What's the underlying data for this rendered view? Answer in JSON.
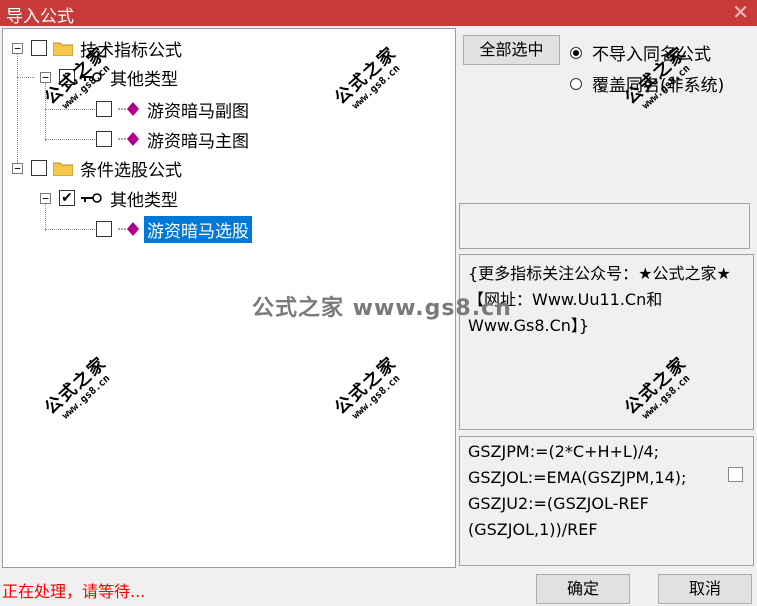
{
  "window": {
    "title": "导入公式",
    "close_glyph": "✕"
  },
  "tree": {
    "nodes": [
      {
        "label": "技术指标公式",
        "expander": "−",
        "checked": false,
        "icon": "folder-icon"
      },
      {
        "label": "其他类型",
        "expander": "−",
        "checked": false,
        "icon": "key-icon"
      },
      {
        "label": "游资暗马副图",
        "checked": false,
        "icon": "gem-icon"
      },
      {
        "label": "游资暗马主图",
        "checked": false,
        "icon": "gem-icon"
      },
      {
        "label": "条件选股公式",
        "expander": "−",
        "checked": false,
        "icon": "folder-icon"
      },
      {
        "label": "其他类型",
        "expander": "−",
        "checked": true,
        "icon": "key-icon"
      },
      {
        "label": "游资暗马选股",
        "checked": false,
        "icon": "gem-icon",
        "selected": true
      }
    ]
  },
  "right": {
    "select_all_label": "全部选中",
    "radio_no_import": "不导入同名公式",
    "radio_overwrite": "覆盖同名(非系统)",
    "desc_text": "{更多指标关注公众号：★公式之家★ 【网址：Www.Uu11.Cn和Www.Gs8.Cn】}",
    "code_lines": [
      "GSZJPM:=(2*C+H+L)/4;",
      "GSZJOL:=EMA(GSZJPM,14);",
      "GSZJU2:=(GSZJOL-REF",
      "(GSZJOL,1))/REF"
    ]
  },
  "status_text": "正在处理，请等待...",
  "buttons": {
    "ok_label": "确定",
    "cancel_label": "取消"
  },
  "watermark": {
    "text": "公式之家",
    "url": "www.gs8.cn",
    "center_text": "公式之家 www.gs8.cn"
  },
  "colors": {
    "titlebar": "#c8393a",
    "selection": "#0078d7",
    "status": "#ff0000",
    "gem": "#b0008c"
  }
}
